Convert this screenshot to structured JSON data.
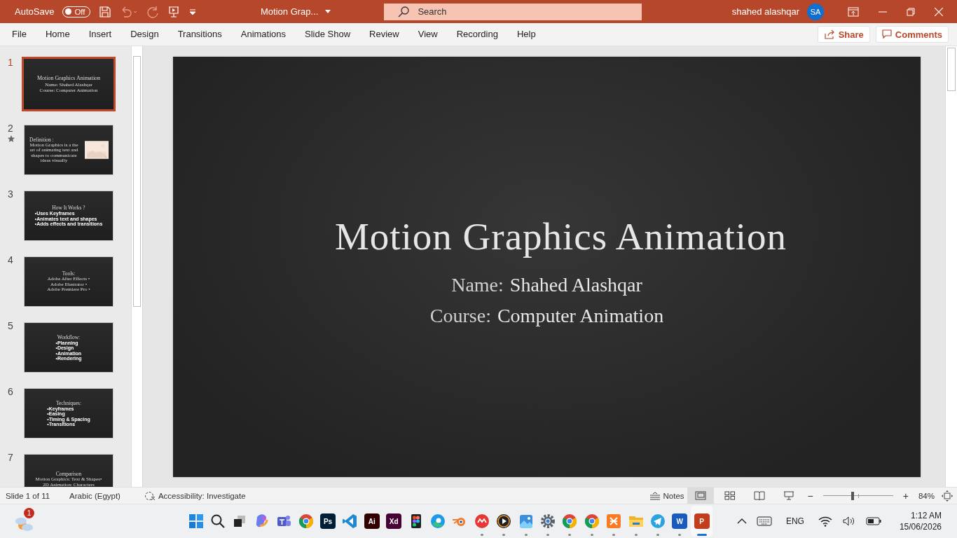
{
  "title_bar": {
    "autosave": {
      "label": "AutoSave",
      "on": false,
      "state_text": "Off"
    },
    "document_title": "Motion Grap...",
    "search": {
      "placeholder": "Search"
    },
    "user_name": "shahed alashqar",
    "avatar_initials": "SA"
  },
  "ribbon_tabs": [
    {
      "label": "File"
    },
    {
      "label": "Home"
    },
    {
      "label": "Insert"
    },
    {
      "label": "Design"
    },
    {
      "label": "Transitions"
    },
    {
      "label": "Animations"
    },
    {
      "label": "Slide Show"
    },
    {
      "label": "Review"
    },
    {
      "label": "View"
    },
    {
      "label": "Recording"
    },
    {
      "label": "Help"
    }
  ],
  "ribbon_actions": {
    "share": "Share",
    "comments": "Comments"
  },
  "slides": [
    {
      "number": "1",
      "selected": true,
      "animated": false,
      "kind": "title",
      "title": "Motion Graphics Animation",
      "lines": [
        "Name: Shahed Alashqar",
        "Course: Computer Animation"
      ]
    },
    {
      "number": "2",
      "selected": false,
      "animated": true,
      "kind": "picture_text",
      "title": "Definition :",
      "lines": [
        "Motion Graphics is a the art of animating text and shapes to communicate ideas visually"
      ]
    },
    {
      "number": "3",
      "selected": false,
      "animated": false,
      "kind": "bullets",
      "title": "How It Works ?",
      "lines": [
        "•Uses Keyframes",
        "•Animates text and shapes",
        "•Adds effects and transitions"
      ]
    },
    {
      "number": "4",
      "selected": false,
      "animated": false,
      "kind": "text",
      "title": "Tools:",
      "lines": [
        "Adobe After Effects •",
        "Adobe Illustrator •",
        "Adobe Premiere Pro •"
      ]
    },
    {
      "number": "5",
      "selected": false,
      "animated": false,
      "kind": "bullets",
      "title": "Workflow:",
      "lines": [
        "•Planning",
        "•Design",
        "•Animation",
        "•Rendering"
      ]
    },
    {
      "number": "6",
      "selected": false,
      "animated": false,
      "kind": "bullets",
      "title": "Techniques:",
      "lines": [
        "•Keyframes",
        "•Easing",
        "•Timing & Spacing",
        "•Transitions"
      ]
    },
    {
      "number": "7",
      "selected": false,
      "animated": false,
      "kind": "text",
      "title": "Comparison",
      "lines": [
        "Motion Graphics: Text & Shapes•",
        "2D Animation: Characters"
      ]
    }
  ],
  "current_slide": {
    "title": "Motion Graphics Animation",
    "lines": [
      {
        "label": "Name:",
        "value": "Shahed Alashqar"
      },
      {
        "label": "Course:",
        "value": "Computer Animation"
      }
    ]
  },
  "status_bar": {
    "slide_count": "Slide 1 of 11",
    "language": "Arabic (Egypt)",
    "accessibility": "Accessibility: Investigate",
    "notes": "Notes",
    "views": [
      {
        "kind": "normal",
        "selected": true
      },
      {
        "kind": "sorter",
        "selected": false
      },
      {
        "kind": "reading",
        "selected": false
      },
      {
        "kind": "slideshow",
        "selected": false
      }
    ],
    "zoom": {
      "minus": "−",
      "plus": "+",
      "level": 0.42,
      "reading": "84%"
    }
  },
  "taskbar": {
    "weather_badge": "1",
    "apps": [
      {
        "kind": "windows",
        "running": false,
        "active": false
      },
      {
        "kind": "search",
        "running": false,
        "active": false
      },
      {
        "kind": "taskview",
        "running": false,
        "active": false
      },
      {
        "kind": "copilot",
        "running": false,
        "active": false
      },
      {
        "kind": "teams",
        "running": false,
        "active": false
      },
      {
        "kind": "chrome",
        "running": false,
        "active": false
      },
      {
        "kind": "tile",
        "label": "Ps",
        "color": "#001e36",
        "running": false,
        "active": false
      },
      {
        "kind": "vscode",
        "running": false,
        "active": false
      },
      {
        "kind": "tile",
        "label": "Ai",
        "color": "#330000",
        "running": false,
        "active": false
      },
      {
        "kind": "tile",
        "label": "Xd",
        "color": "#470137",
        "running": false,
        "active": false
      },
      {
        "kind": "figma",
        "running": false,
        "active": false
      },
      {
        "kind": "edge",
        "running": false,
        "active": false
      },
      {
        "kind": "blender",
        "running": false,
        "active": false
      },
      {
        "kind": "redcircle",
        "running": true,
        "active": false
      },
      {
        "kind": "player",
        "running": true,
        "active": false
      },
      {
        "kind": "photos",
        "running": true,
        "active": false
      },
      {
        "kind": "settings",
        "running": true,
        "active": false
      },
      {
        "kind": "chrome",
        "running": true,
        "active": false
      },
      {
        "kind": "chrome",
        "running": true,
        "active": false
      },
      {
        "kind": "xampp",
        "running": true,
        "active": false
      },
      {
        "kind": "folder",
        "running": true,
        "active": false
      },
      {
        "kind": "telegram",
        "running": true,
        "active": false
      },
      {
        "kind": "tile",
        "label": "W",
        "color": "#185abd",
        "running": true,
        "active": false
      },
      {
        "kind": "tile",
        "label": "P",
        "color": "#c43e1c",
        "running": true,
        "active": true
      }
    ],
    "tray": {
      "language": "ENG",
      "time": "1:12 AM",
      "date": "15/06/2026"
    }
  }
}
